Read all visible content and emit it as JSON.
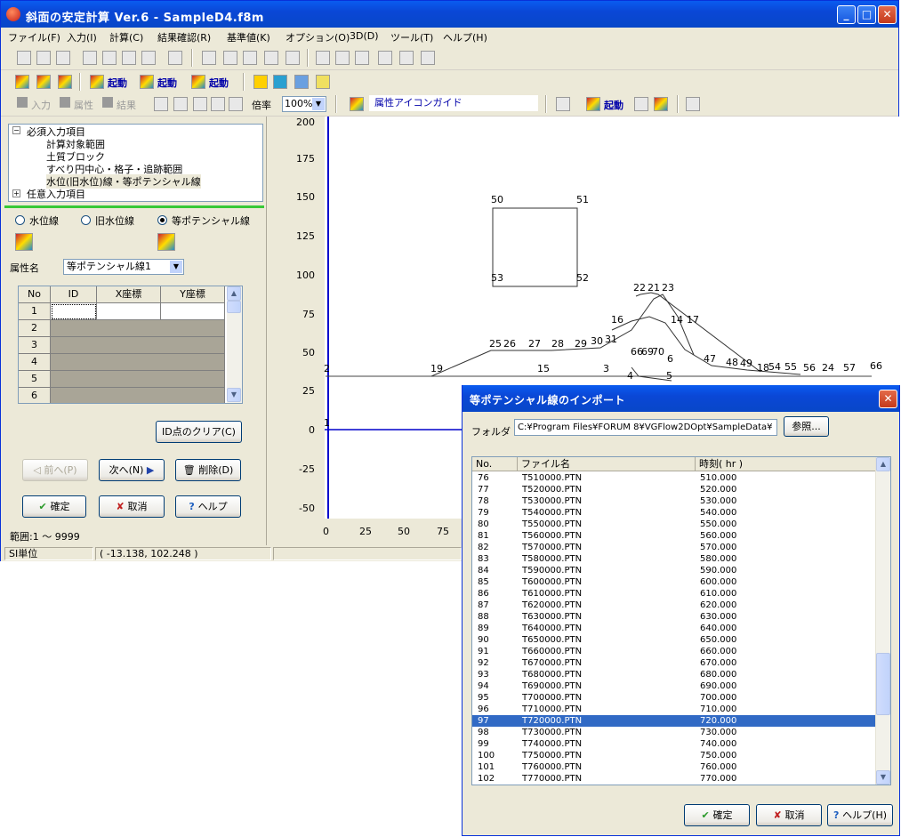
{
  "app": {
    "title": "斜面の安定計算 Ver.6 - SampleD4.f8m",
    "window_buttons": [
      "_",
      "□",
      "✕"
    ]
  },
  "menu": [
    "ファイル(F)",
    "入力(I)",
    "計算(C)",
    "結果確認(R)",
    "基準値(K)",
    "オプション(O)",
    "3D(D)",
    "ツール(T)",
    "ヘルプ(H)"
  ],
  "toolbar2": {
    "start1": "起動",
    "start2": "起動",
    "start3": "起動"
  },
  "toolbar3": {
    "input": "入力",
    "attr": "属性",
    "result": "結果",
    "zoom_label": "倍率",
    "zoom_value": "100%",
    "guide": "属性アイコンガイド",
    "start": "起動"
  },
  "tree": {
    "root": "必須入力項目",
    "items": [
      "計算対象範囲",
      "土質ブロック",
      "すべり円中心・格子・追跡範囲",
      "水位(旧水位)線・等ポテンシャル線"
    ],
    "optional": "任意入力項目"
  },
  "radios": {
    "r1": "水位線",
    "r2": "旧水位線",
    "r3": "等ポテンシャル線",
    "selected": "等ポテンシャル線"
  },
  "attr": {
    "label": "属性名",
    "value": "等ポテンシャル線1"
  },
  "grid": {
    "headers": [
      "No",
      "ID",
      "X座標",
      "Y座標"
    ],
    "rows": [
      "1",
      "2",
      "3",
      "4",
      "5",
      "6"
    ]
  },
  "buttons": {
    "clear": "ID点のクリア(C)",
    "prev": "前へ(P)",
    "next": "次へ(N)",
    "delete": "削除(D)",
    "ok": "確定",
    "cancel": "取消",
    "help": "ヘルプ"
  },
  "range": "範囲:1 ～ 9999",
  "status": {
    "unit": "SI単位",
    "coords": "( -13.138, 102.248 )"
  },
  "axis": {
    "y": [
      "200",
      "175",
      "150",
      "125",
      "100",
      "75",
      "50",
      "25",
      "0",
      "-25",
      "-50"
    ],
    "x": [
      "0",
      "25",
      "50",
      "75"
    ]
  },
  "plot_labels": [
    "50",
    "51",
    "53",
    "52",
    "22",
    "21",
    "23",
    "16",
    "14",
    "17",
    "25",
    "26",
    "27",
    "28",
    "29",
    "30",
    "31",
    "66",
    "69",
    "70",
    "6",
    "47",
    "48",
    "49",
    "18",
    "54",
    "55",
    "56",
    "24",
    "57",
    "66",
    "2",
    "19",
    "15",
    "3",
    "4",
    "5",
    "1"
  ],
  "dialog": {
    "title": "等ポテンシャル線のインポート",
    "folder_label": "フォルダ",
    "folder": "C:¥Program Files¥FORUM 8¥VGFlow2DOpt¥SampleData¥",
    "browse": "参照...",
    "headers": [
      "No.",
      "ファイル名",
      "時刻( hr )"
    ],
    "rows": [
      [
        "76",
        "T510000.PTN",
        "510.000"
      ],
      [
        "77",
        "T520000.PTN",
        "520.000"
      ],
      [
        "78",
        "T530000.PTN",
        "530.000"
      ],
      [
        "79",
        "T540000.PTN",
        "540.000"
      ],
      [
        "80",
        "T550000.PTN",
        "550.000"
      ],
      [
        "81",
        "T560000.PTN",
        "560.000"
      ],
      [
        "82",
        "T570000.PTN",
        "570.000"
      ],
      [
        "83",
        "T580000.PTN",
        "580.000"
      ],
      [
        "84",
        "T590000.PTN",
        "590.000"
      ],
      [
        "85",
        "T600000.PTN",
        "600.000"
      ],
      [
        "86",
        "T610000.PTN",
        "610.000"
      ],
      [
        "87",
        "T620000.PTN",
        "620.000"
      ],
      [
        "88",
        "T630000.PTN",
        "630.000"
      ],
      [
        "89",
        "T640000.PTN",
        "640.000"
      ],
      [
        "90",
        "T650000.PTN",
        "650.000"
      ],
      [
        "91",
        "T660000.PTN",
        "660.000"
      ],
      [
        "92",
        "T670000.PTN",
        "670.000"
      ],
      [
        "93",
        "T680000.PTN",
        "680.000"
      ],
      [
        "94",
        "T690000.PTN",
        "690.000"
      ],
      [
        "95",
        "T700000.PTN",
        "700.000"
      ],
      [
        "96",
        "T710000.PTN",
        "710.000"
      ],
      [
        "97",
        "T720000.PTN",
        "720.000"
      ],
      [
        "98",
        "T730000.PTN",
        "730.000"
      ],
      [
        "99",
        "T740000.PTN",
        "740.000"
      ],
      [
        "100",
        "T750000.PTN",
        "750.000"
      ],
      [
        "101",
        "T760000.PTN",
        "760.000"
      ],
      [
        "102",
        "T770000.PTN",
        "770.000"
      ]
    ],
    "selected_no": "97",
    "ok": "確定",
    "cancel": "取消",
    "help": "ヘルプ(H)"
  }
}
